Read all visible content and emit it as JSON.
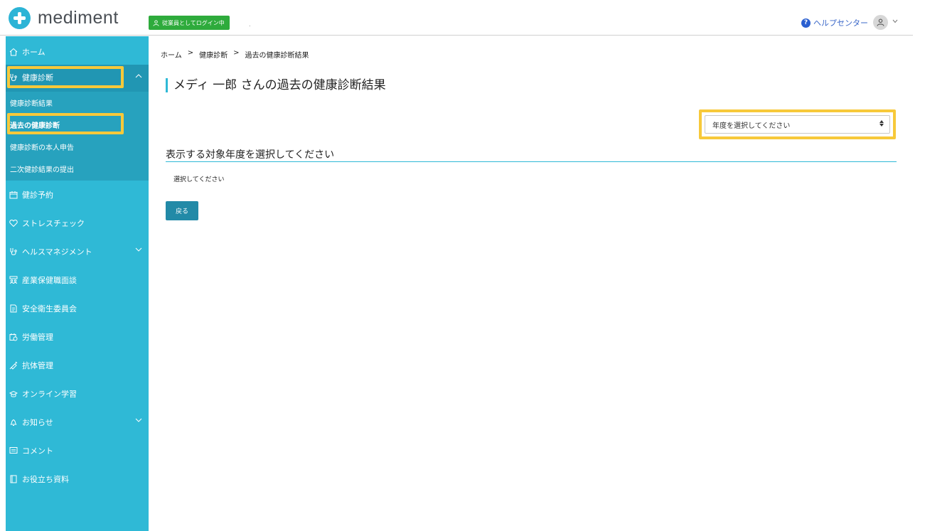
{
  "header": {
    "logo_text": "mediment",
    "login_badge": "従業員としてログイン中",
    "separator": ".",
    "help_label": "ヘルプセンター",
    "help_icon_text": "?"
  },
  "sidebar": {
    "home": "ホーム",
    "checkup": "健康診断",
    "sub_items": [
      "健康診断結果",
      "過去の健康診断",
      "健康診断の本人申告",
      "二次健診結果の提出"
    ],
    "items": [
      {
        "label": "健診予約",
        "icon": "calendar-icon"
      },
      {
        "label": "ストレスチェック",
        "icon": "heart-icon"
      },
      {
        "label": "ヘルスマネジメント",
        "icon": "stethoscope-icon"
      },
      {
        "label": "産業保健職面談",
        "icon": "people-icon"
      },
      {
        "label": "安全衛生委員会",
        "icon": "document-icon"
      },
      {
        "label": "労働管理",
        "icon": "clock-calendar-icon"
      },
      {
        "label": "抗体管理",
        "icon": "syringe-icon"
      },
      {
        "label": "オンライン学習",
        "icon": "graduation-cap-icon"
      },
      {
        "label": "お知らせ",
        "icon": "bell-icon"
      },
      {
        "label": "コメント",
        "icon": "comment-icon"
      },
      {
        "label": "お役立ち資料",
        "icon": "book-icon"
      }
    ]
  },
  "breadcrumb": {
    "home": "ホーム",
    "sep": ">",
    "checkup": "健康診断",
    "current": "過去の健康診断結果"
  },
  "main": {
    "title": "メディ 一郎 さんの過去の健康診断結果",
    "select_placeholder": "年度を選択してください",
    "section_title": "表示する対象年度を選択してください",
    "placeholder_text": "選択してください",
    "back_label": "戻る"
  },
  "colors": {
    "accent": "#2fb9d6",
    "highlight": "#f7c93a",
    "badge": "#2eab3c",
    "button": "#228aa7"
  }
}
